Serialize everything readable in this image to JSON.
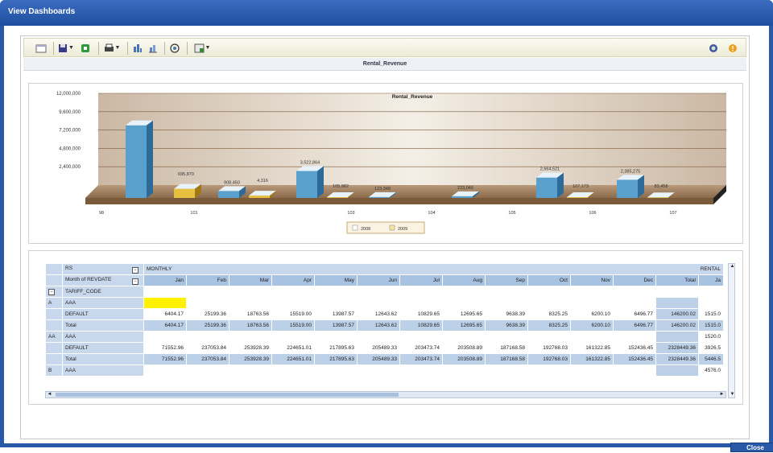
{
  "window": {
    "title": "View Dashboards",
    "close_label": "Close"
  },
  "toolbar": {
    "icons": [
      "new-icon",
      "save-icon",
      "export-excel-icon",
      "print-icon",
      "chart-type-icon",
      "chart-options-icon",
      "settings-icon",
      "layout-icon",
      "help-icon",
      "info-icon"
    ]
  },
  "dashboard": {
    "title": "Rental_Revenue"
  },
  "chart_data": {
    "type": "bar",
    "title": "Rental_Revenue",
    "categories": [
      "98",
      "101",
      "103",
      "104",
      "105",
      "106",
      "107"
    ],
    "yticks": [
      "12,000,000",
      "9,600,000",
      "7,200,000",
      "4,800,000",
      "2,400,000"
    ],
    "ylim": [
      0,
      12000000
    ],
    "series": [
      {
        "name": "2008",
        "color": "#5aa0cc",
        "values": [
          9500000,
          908450,
          3522864,
          123348,
          223046,
          2664521,
          2385275
        ]
      },
      {
        "name": "2009",
        "color": "#e8c040",
        "values": [
          0,
          0,
          105982,
          0,
          0,
          107173,
          83458
        ]
      }
    ],
    "data_labels": [
      "695,870",
      "908,450",
      "4,316",
      "3,522,864",
      "105,982",
      "123,348",
      "223,046",
      "2,664,521",
      "107,173",
      "2,385,275",
      "83,458"
    ]
  },
  "grid": {
    "corner_label": "RS",
    "measure_label": "MONTHLY",
    "month_label": "Month of REVDATE",
    "tariff_label": "TARIFF_CODE",
    "next_measure": "RENTAL",
    "months": [
      "Jan",
      "Feb",
      "Mar",
      "Apr",
      "May",
      "Jun",
      "Jul",
      "Aug",
      "Sep",
      "Oct",
      "Nov",
      "Dec",
      "Total",
      "Ja"
    ],
    "rows": [
      {
        "rs": "A",
        "tc": "AAA",
        "vals": [
          "",
          "",
          "",
          "",
          "",
          "",
          "",
          "",
          "",
          "",
          "",
          "",
          "",
          ""
        ],
        "type": "ylw"
      },
      {
        "rs": "",
        "tc": "DEFAULT",
        "vals": [
          "6404.17",
          "25199.36",
          "18763.56",
          "15519.00",
          "13987.57",
          "12643.62",
          "10829.65",
          "12695.65",
          "9638.39",
          "8325.25",
          "6200.10",
          "6496.77",
          "146200.02",
          "1515.0"
        ],
        "type": "data"
      },
      {
        "rs": "",
        "tc": "Total",
        "vals": [
          "6404.17",
          "25199.36",
          "18763.56",
          "15519.00",
          "13987.57",
          "12643.62",
          "10829.65",
          "12695.65",
          "9638.39",
          "8325.25",
          "6200.10",
          "6496.77",
          "146200.02",
          "1515.0"
        ],
        "type": "total"
      },
      {
        "rs": "AA",
        "tc": "AAA",
        "vals": [
          "",
          "",
          "",
          "",
          "",
          "",
          "",
          "",
          "",
          "",
          "",
          "",
          "",
          "1520.0"
        ],
        "type": "data"
      },
      {
        "rs": "",
        "tc": "DEFAULT",
        "vals": [
          "71552.96",
          "237053.84",
          "253928.39",
          "224651.01",
          "217895.63",
          "205489.33",
          "203473.74",
          "203508.89",
          "187168.58",
          "192768.03",
          "161322.85",
          "152436.45",
          "2328449.36",
          "3926.5"
        ],
        "type": "data"
      },
      {
        "rs": "",
        "tc": "Total",
        "vals": [
          "71552.96",
          "237053.84",
          "253928.39",
          "224651.01",
          "217895.63",
          "205489.33",
          "203473.74",
          "203508.89",
          "187168.58",
          "192768.03",
          "161322.85",
          "152436.45",
          "2328449.36",
          "5446.5"
        ],
        "type": "total"
      },
      {
        "rs": "B",
        "tc": "AAA",
        "vals": [
          "",
          "",
          "",
          "",
          "",
          "",
          "",
          "",
          "",
          "",
          "",
          "",
          "",
          "4576.0"
        ],
        "type": "data"
      }
    ]
  }
}
